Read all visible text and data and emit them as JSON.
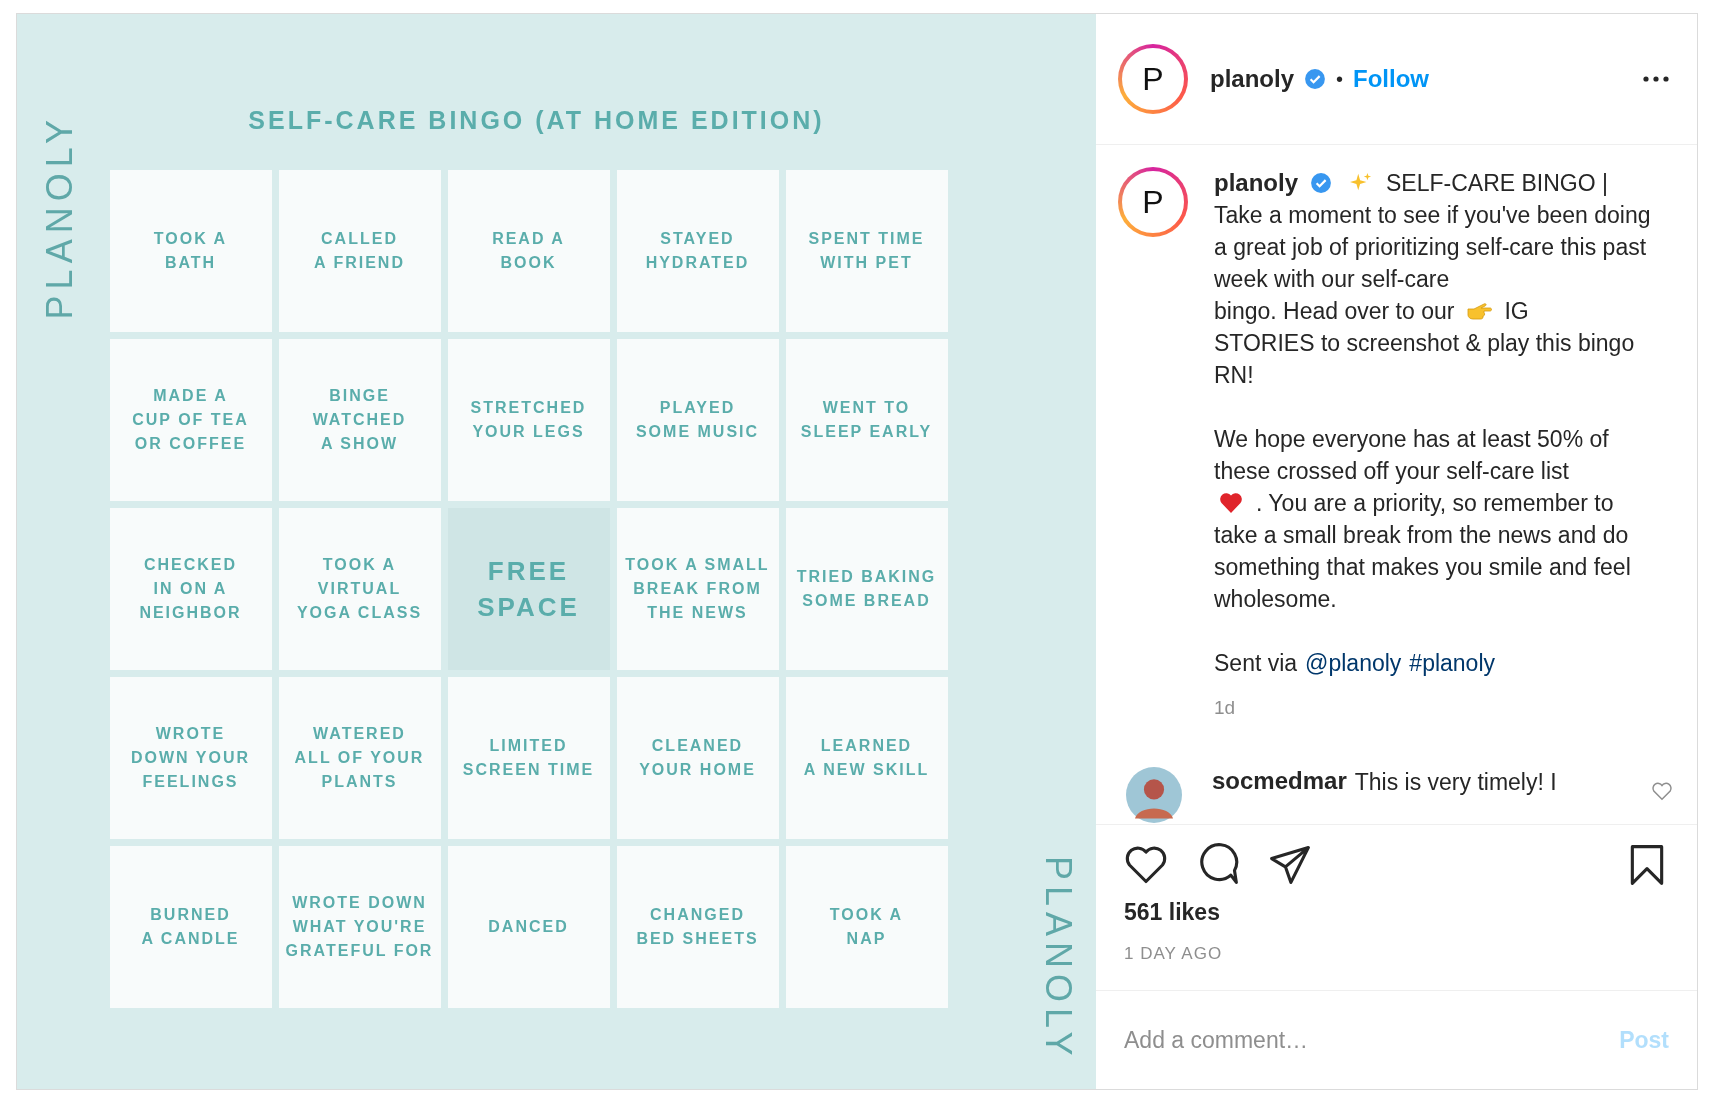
{
  "post_image": {
    "title": "SELF-CARE BINGO (AT HOME EDITION)",
    "side_mark_left": "PLANOLY",
    "side_mark_right": "PLANOLY",
    "cells": [
      {
        "kind": "task",
        "text": "TOOK A\nBATH"
      },
      {
        "kind": "task",
        "text": "CALLED\nA FRIEND"
      },
      {
        "kind": "task",
        "text": "READ A\nBOOK"
      },
      {
        "kind": "task",
        "text": "STAYED\nHYDRATED"
      },
      {
        "kind": "task",
        "text": "SPENT TIME\nWITH PET"
      },
      {
        "kind": "task",
        "text": "MADE A\nCUP OF TEA\nOR COFFEE"
      },
      {
        "kind": "task",
        "text": "BINGE\nWATCHED\nA SHOW"
      },
      {
        "kind": "task",
        "text": "STRETCHED\nYOUR LEGS"
      },
      {
        "kind": "task",
        "text": "PLAYED\nSOME MUSIC"
      },
      {
        "kind": "task",
        "text": "WENT TO\nSLEEP EARLY"
      },
      {
        "kind": "task",
        "text": "CHECKED\nIN ON A\nNEIGHBOR"
      },
      {
        "kind": "task",
        "text": "TOOK A\nVIRTUAL\nYOGA CLASS"
      },
      {
        "kind": "free",
        "text": "FREE\nSPACE"
      },
      {
        "kind": "task",
        "text": "TOOK A SMALL\nBREAK FROM\nTHE NEWS"
      },
      {
        "kind": "task",
        "text": "TRIED BAKING\nSOME BREAD"
      },
      {
        "kind": "task",
        "text": "WROTE\nDOWN YOUR\nFEELINGS"
      },
      {
        "kind": "task",
        "text": "WATERED\nALL OF YOUR\nPLANTS"
      },
      {
        "kind": "task",
        "text": "LIMITED\nSCREEN TIME"
      },
      {
        "kind": "task",
        "text": "CLEANED\nYOUR HOME"
      },
      {
        "kind": "task",
        "text": "LEARNED\nA NEW SKILL"
      },
      {
        "kind": "task",
        "text": "BURNED\nA CANDLE"
      },
      {
        "kind": "task",
        "text": "WROTE DOWN\nWHAT YOU'RE\nGRATEFUL FOR"
      },
      {
        "kind": "task",
        "text": "DANCED"
      },
      {
        "kind": "task",
        "text": "CHANGED\nBED SHEETS"
      },
      {
        "kind": "task",
        "text": "TOOK A\nNAP"
      }
    ]
  },
  "header": {
    "avatar_letter": "P",
    "username": "planoly",
    "separator": "•",
    "follow": "Follow"
  },
  "caption": {
    "avatar_letter": "P",
    "username": "planoly",
    "text_1": "SELF-CARE BINGO |",
    "text_2": "Take a moment to see if you've been doing a great job of prioritizing self-care this past week with our self-care",
    "text_3": "bingo. Head over to our",
    "text_4": "IG",
    "text_5": "STORIES to screenshot & play this bingo RN!",
    "text_6": "We hope everyone has at least 50% of these crossed off your self-care list",
    "text_7": ". You are a priority, so remember to",
    "text_8": "take a small break from the news and do something that makes you smile and feel wholesome.",
    "sent_via": "Sent via",
    "mention": "@planoly",
    "hashtag": "#planoly",
    "time": "1d"
  },
  "comment": {
    "username": "socmedmar",
    "text": "This is very timely! I"
  },
  "likes": "561 likes",
  "posted": "1 DAY AGO",
  "comment_box": {
    "placeholder": "Add a comment…",
    "post": "Post",
    "disabled": true
  }
}
